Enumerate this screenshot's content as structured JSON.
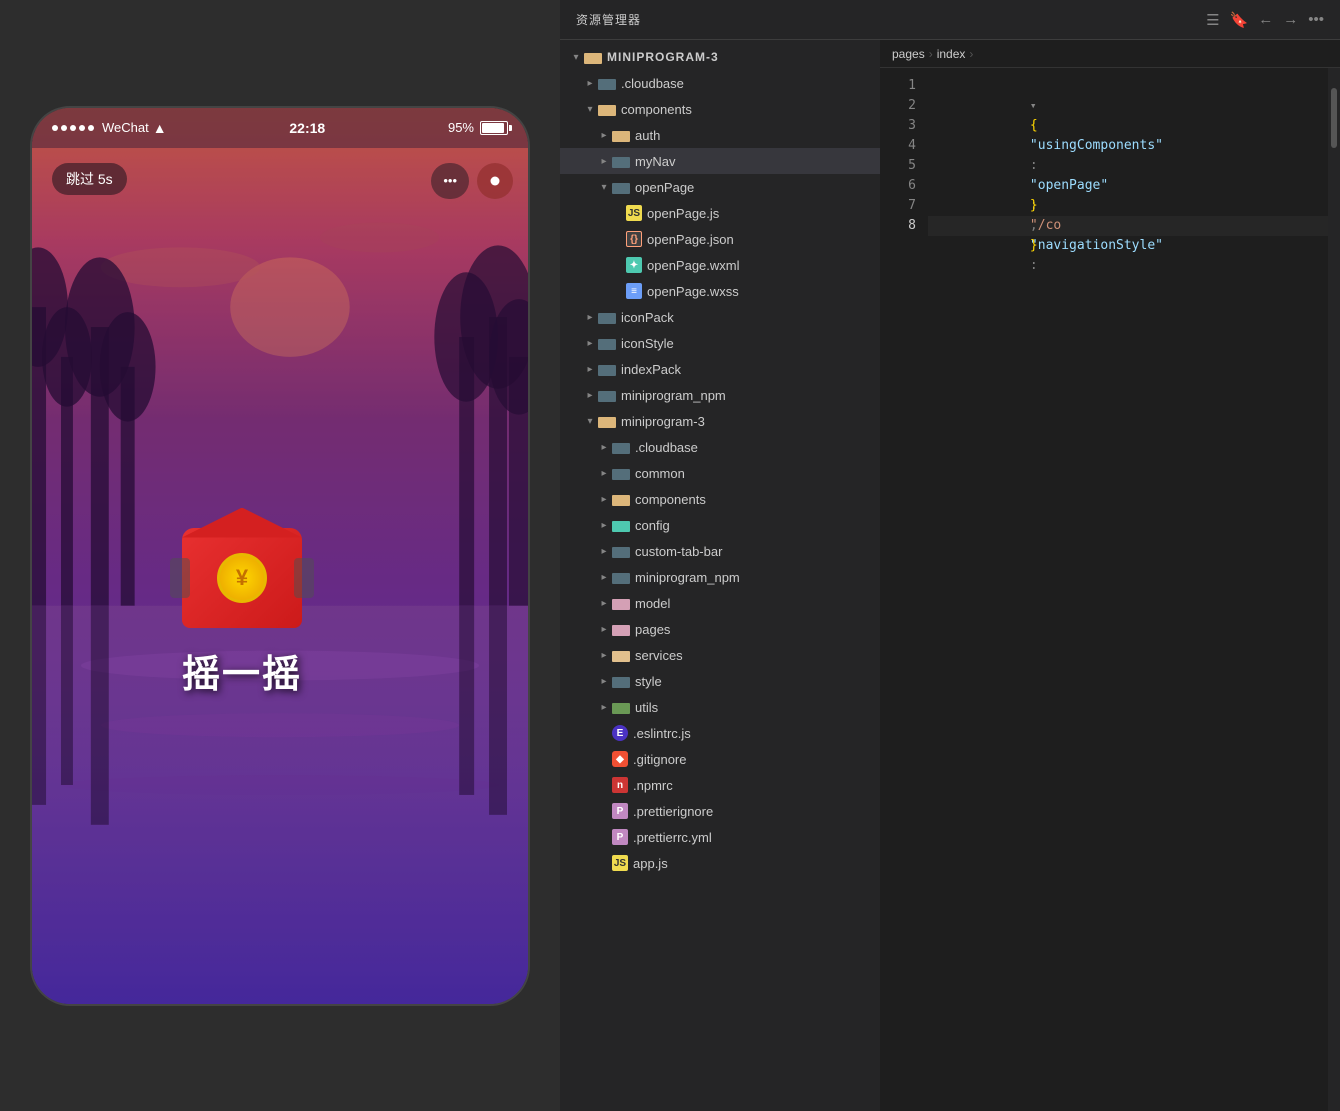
{
  "phone": {
    "status": {
      "signal_dots": 5,
      "carrier": "WeChat",
      "wifi": "📶",
      "time": "22:18",
      "battery_percent": "95%"
    },
    "skip_button": "跳过 5s",
    "more_btn": "•••",
    "shake_text": "摇一摇",
    "yuan_symbol": "¥"
  },
  "explorer": {
    "header": {
      "title": "资源管理器",
      "more_icon": "•••"
    },
    "toolbar_icons": [
      "list-icon",
      "bookmark-icon",
      "back-icon",
      "forward-icon"
    ],
    "breadcrumb": {
      "parts": [
        "pages",
        ">",
        "index",
        ">"
      ]
    }
  },
  "file_tree": {
    "root": "MINIPROGRAM-3",
    "items": [
      {
        "id": "cloudbase-top",
        "indent": 1,
        "type": "folder",
        "color": "gray",
        "label": ".cloudbase",
        "open": false
      },
      {
        "id": "components-top",
        "indent": 1,
        "type": "folder",
        "color": "yellow",
        "label": "components",
        "open": true
      },
      {
        "id": "auth",
        "indent": 2,
        "type": "folder",
        "color": "yellow",
        "label": "auth",
        "open": false
      },
      {
        "id": "myNav",
        "indent": 2,
        "type": "folder",
        "color": "gray",
        "label": "myNav",
        "open": false,
        "selected": true
      },
      {
        "id": "openPage",
        "indent": 2,
        "type": "folder",
        "color": "gray",
        "label": "openPage",
        "open": true
      },
      {
        "id": "openPage-js",
        "indent": 3,
        "type": "file",
        "fileType": "js",
        "label": "openPage.js"
      },
      {
        "id": "openPage-json",
        "indent": 3,
        "type": "file",
        "fileType": "json",
        "label": "openPage.json"
      },
      {
        "id": "openPage-wxml",
        "indent": 3,
        "type": "file",
        "fileType": "wxml",
        "label": "openPage.wxml"
      },
      {
        "id": "openPage-wxss",
        "indent": 3,
        "type": "file",
        "fileType": "wxss",
        "label": "openPage.wxss"
      },
      {
        "id": "iconPack",
        "indent": 1,
        "type": "folder",
        "color": "gray",
        "label": "iconPack",
        "open": false
      },
      {
        "id": "iconStyle",
        "indent": 1,
        "type": "folder",
        "color": "gray",
        "label": "iconStyle",
        "open": false
      },
      {
        "id": "indexPack",
        "indent": 1,
        "type": "folder",
        "color": "gray",
        "label": "indexPack",
        "open": false
      },
      {
        "id": "miniprogram_npm-top",
        "indent": 1,
        "type": "folder",
        "color": "gray",
        "label": "miniprogram_npm",
        "open": false
      },
      {
        "id": "miniprogram-3",
        "indent": 1,
        "type": "folder",
        "color": "yellow",
        "label": "miniprogram-3",
        "open": true
      },
      {
        "id": "cloudbase-inner",
        "indent": 2,
        "type": "folder",
        "color": "gray",
        "label": ".cloudbase",
        "open": false
      },
      {
        "id": "common",
        "indent": 2,
        "type": "folder",
        "color": "gray",
        "label": "common",
        "open": false
      },
      {
        "id": "components-inner",
        "indent": 2,
        "type": "folder",
        "color": "yellow",
        "label": "components",
        "open": false
      },
      {
        "id": "config",
        "indent": 2,
        "type": "folder",
        "color": "teal",
        "label": "config",
        "open": false
      },
      {
        "id": "custom-tab-bar",
        "indent": 2,
        "type": "folder",
        "color": "gray",
        "label": "custom-tab-bar",
        "open": false
      },
      {
        "id": "miniprogram_npm-inner",
        "indent": 2,
        "type": "folder",
        "color": "gray",
        "label": "miniprogram_npm",
        "open": false
      },
      {
        "id": "model",
        "indent": 2,
        "type": "folder",
        "color": "pink",
        "label": "model",
        "open": false
      },
      {
        "id": "pages",
        "indent": 2,
        "type": "folder",
        "color": "pink",
        "label": "pages",
        "open": false
      },
      {
        "id": "services",
        "indent": 2,
        "type": "folder",
        "color": "yellow2",
        "label": "services",
        "open": false
      },
      {
        "id": "style",
        "indent": 2,
        "type": "folder",
        "color": "gray",
        "label": "style",
        "open": false
      },
      {
        "id": "utils",
        "indent": 2,
        "type": "folder",
        "color": "green",
        "label": "utils",
        "open": false
      },
      {
        "id": "eslintrc",
        "indent": 2,
        "type": "file",
        "fileType": "eslint",
        "label": ".eslintrc.js"
      },
      {
        "id": "gitignore",
        "indent": 2,
        "type": "file",
        "fileType": "git",
        "label": ".gitignore"
      },
      {
        "id": "npmrc",
        "indent": 2,
        "type": "file",
        "fileType": "npm",
        "label": ".npmrc"
      },
      {
        "id": "prettierignore",
        "indent": 2,
        "type": "file",
        "fileType": "prettier",
        "label": ".prettierignore"
      },
      {
        "id": "prettierrc-yml",
        "indent": 2,
        "type": "file",
        "fileType": "prettier",
        "label": ".prettierrc.yml"
      },
      {
        "id": "app-js",
        "indent": 2,
        "type": "file",
        "fileType": "js",
        "label": "app.js"
      }
    ]
  },
  "code": {
    "breadcrumb": "pages  >  index  >",
    "lines": [
      {
        "num": 1,
        "content": "{",
        "active": false
      },
      {
        "num": 2,
        "content": "  \"usingComponents\":",
        "active": false
      },
      {
        "num": 3,
        "content": "",
        "active": false
      },
      {
        "num": 4,
        "content": "    \"openPage\": \"/co",
        "active": false
      },
      {
        "num": 5,
        "content": "  },",
        "active": false
      },
      {
        "num": 6,
        "content": "",
        "active": false
      },
      {
        "num": 7,
        "content": "  \"navigationStyle\":",
        "active": false
      },
      {
        "num": 8,
        "content": "}",
        "active": true
      }
    ]
  }
}
